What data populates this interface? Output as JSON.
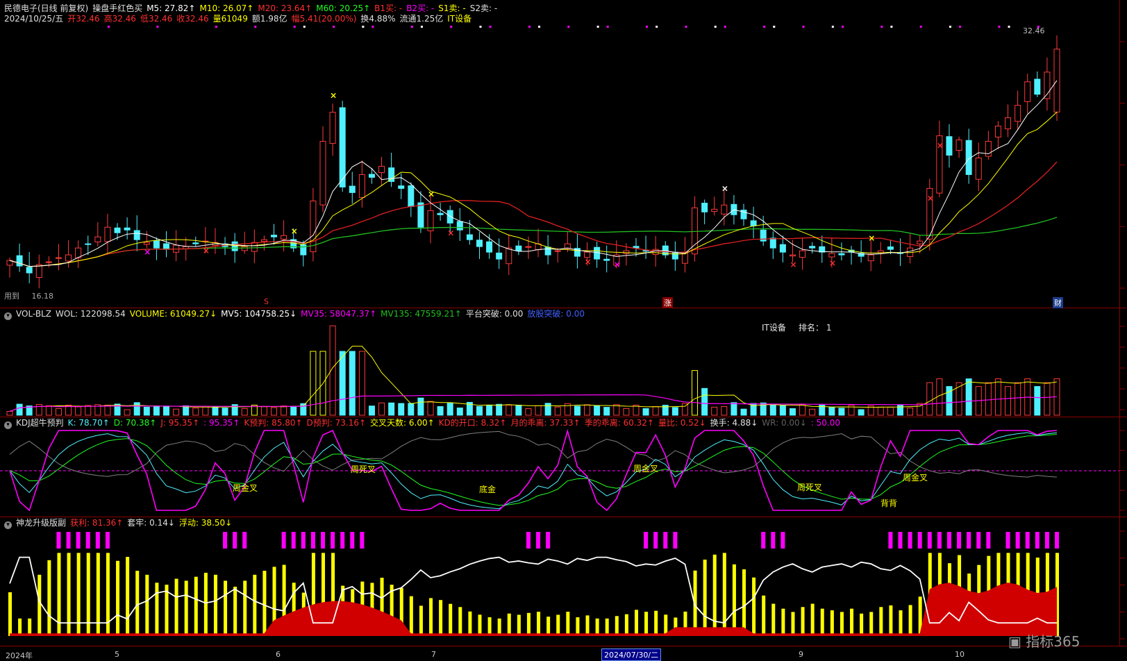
{
  "colors": {
    "up": "#ff3a3a",
    "down": "#4ff0ff",
    "ma5": "#ffffff",
    "ma10": "#ffff00",
    "ma20": "#e02020",
    "ma60": "#20c020",
    "magenta": "#ff00ff",
    "yellow": "#ffff00",
    "grid": "#8b0000"
  },
  "price_panel": {
    "title_parts": [
      {
        "text": "民德电子(日线 前复权)",
        "color": "#e0e0e0"
      },
      {
        "text": "操盘手红色买",
        "color": "#e0e0e0"
      },
      {
        "text": "M5: 27.82↑",
        "color": "#ffffff"
      },
      {
        "text": "M10: 26.07↑",
        "color": "#ffff00"
      },
      {
        "text": "M20: 23.64↑",
        "color": "#ff3030"
      },
      {
        "text": "M60: 20.25↑",
        "color": "#20ff20"
      },
      {
        "text": "B1买: -",
        "color": "#ff3030"
      },
      {
        "text": "B2买: -",
        "color": "#ff00ff"
      },
      {
        "text": "S1卖: -",
        "color": "#ffff00"
      },
      {
        "text": "S2卖: -",
        "color": "#e0e0e0"
      }
    ],
    "info_parts": [
      {
        "text": "2024/10/25/五",
        "color": "#e0e0e0"
      },
      {
        "text": "开32.46",
        "color": "#ff3030"
      },
      {
        "text": "高32.46",
        "color": "#ff3030"
      },
      {
        "text": "低32.46",
        "color": "#ff3030"
      },
      {
        "text": "收32.46",
        "color": "#ff3030"
      },
      {
        "text": "量61049",
        "color": "#ffff00"
      },
      {
        "text": "额1.98亿",
        "color": "#e0e0e0"
      },
      {
        "text": "幅5.41(20.00%)",
        "color": "#ff3030"
      },
      {
        "text": "换4.88%",
        "color": "#e0e0e0"
      },
      {
        "text": "流通1.25亿",
        "color": "#e0e0e0"
      },
      {
        "text": "IT设备",
        "color": "#ffff00"
      }
    ],
    "latest_price_label": "32.46",
    "low_label": "16.18",
    "low_prefix": "用到",
    "marker_s": "S",
    "marker_zhang": "涨",
    "marker_cai": "财"
  },
  "vol_panel": {
    "title_parts": [
      {
        "text": "VOL-BLZ",
        "color": "#e0e0e0"
      },
      {
        "text": "WOL: 122098.54",
        "color": "#e0e0e0"
      },
      {
        "text": "VOLUME: 61049.27↓",
        "color": "#ffff00"
      },
      {
        "text": "MV5: 104758.25↓",
        "color": "#ffffff"
      },
      {
        "text": "MV35: 58047.37↑",
        "color": "#ff00ff"
      },
      {
        "text": "MV135: 47559.21↑",
        "color": "#20c020"
      },
      {
        "text": "平台突破: 0.00",
        "color": "#e0e0e0"
      },
      {
        "text": "放股突破: 0.00",
        "color": "#4060ff"
      }
    ],
    "sector": "IT设备",
    "rank_label": "排名：",
    "rank": "1"
  },
  "kdj_panel": {
    "title_parts": [
      {
        "text": "KDJ超牛预判",
        "color": "#e0e0e0"
      },
      {
        "text": "K: 78.70↑",
        "color": "#4ff0ff"
      },
      {
        "text": "D: 70.38↑",
        "color": "#20ff20"
      },
      {
        "text": "J: 95.35↑",
        "color": "#ff3030"
      },
      {
        "text": ": 95.35↑",
        "color": "#ff00ff"
      },
      {
        "text": "K预判: 85.80↑",
        "color": "#ff3030"
      },
      {
        "text": "D预判: 73.16↑",
        "color": "#ff3030"
      },
      {
        "text": "交叉天数: 6.00↑",
        "color": "#ffff00"
      },
      {
        "text": "KD的开口: 8.32↑",
        "color": "#ff3030"
      },
      {
        "text": "月的乖离: 37.33↑",
        "color": "#ff3030"
      },
      {
        "text": "季的乖离: 60.32↑",
        "color": "#ff3030"
      },
      {
        "text": "量比: 0.52↓",
        "color": "#ff3030"
      },
      {
        "text": "换手: 4.88↓",
        "color": "#e0e0e0"
      },
      {
        "text": "WR: 0.00↓",
        "color": "#606060"
      },
      {
        "text": ": 50.00",
        "color": "#ff00ff"
      }
    ],
    "labels": [
      "周金叉",
      "周死叉",
      "底金",
      "周金叉",
      "周死叉",
      "背背",
      "周金叉"
    ]
  },
  "shenlong_panel": {
    "title_parts": [
      {
        "text": "神龙升级版副",
        "color": "#e0e0e0"
      },
      {
        "text": "获利: 81.36↑",
        "color": "#ff3030"
      },
      {
        "text": "套牢: 0.14↓",
        "color": "#e0e0e0"
      },
      {
        "text": "浮动: 38.50↓",
        "color": "#ffff00"
      }
    ]
  },
  "x_axis": {
    "labels": [
      {
        "text": "2024年"
      },
      {
        "text": "5"
      },
      {
        "text": "6"
      },
      {
        "text": "7"
      },
      {
        "text": "9"
      },
      {
        "text": "10"
      }
    ],
    "crosshair_date": "2024/07/30/二"
  },
  "chart_data": {
    "type": "candlestick",
    "series_names": [
      "M5",
      "M10",
      "M20",
      "M60"
    ],
    "latest": {
      "date": "2024/10/25",
      "open": 32.46,
      "high": 32.46,
      "low": 32.46,
      "close": 32.46,
      "volume": 61049,
      "M5": 27.82,
      "M10": 26.07,
      "M20": 23.64,
      "M60": 20.25
    },
    "period_low": 16.18,
    "closes": [
      17.2,
      16.8,
      16.3,
      16.9,
      17.1,
      17.4,
      17.6,
      18.1,
      18.4,
      18.9,
      19.6,
      19.2,
      19.4,
      18.7,
      18.5,
      18.1,
      18.0,
      18.3,
      18.2,
      18.4,
      18.6,
      18.5,
      18.2,
      17.9,
      18.2,
      18.5,
      18.7,
      18.9,
      19.0,
      18.1,
      17.6,
      21.5,
      25.8,
      27.9,
      22.5,
      22.1,
      23.4,
      23.2,
      24.0,
      22.9,
      22.4,
      21.1,
      19.6,
      20.8,
      20.5,
      19.9,
      19.4,
      18.7,
      18.2,
      17.8,
      17.3,
      18.1,
      17.9,
      18.2,
      18.4,
      17.6,
      17.9,
      18.4,
      17.5,
      17.8,
      17.3,
      17.2,
      17.6,
      17.9,
      18.1,
      17.9,
      18.0,
      17.6,
      17.3,
      17.8,
      21.0,
      20.7,
      20.9,
      21.2,
      20.5,
      20.2,
      19.7,
      18.6,
      18.1,
      17.8,
      17.6,
      17.9,
      18.1,
      17.8,
      17.7,
      17.6,
      17.8,
      17.5,
      17.6,
      17.9,
      18.0,
      17.7,
      18.1,
      18.6,
      22.4,
      26.2,
      24.8,
      25.9,
      23.4,
      24.6,
      25.8,
      26.9,
      27.5,
      28.4,
      30.1,
      29.2,
      30.8,
      32.46
    ]
  }
}
